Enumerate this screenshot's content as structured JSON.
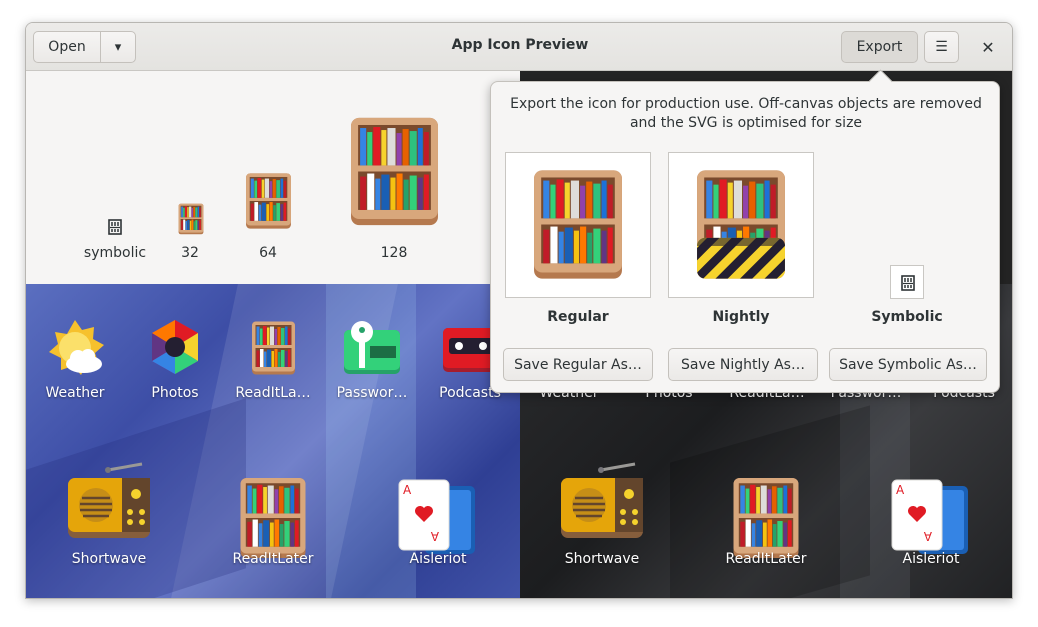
{
  "header": {
    "open_label": "Open",
    "title": "App Icon Preview",
    "export_label": "Export",
    "close_glyph": "✕",
    "menu_glyph": "☰",
    "dropdown_glyph": "▾"
  },
  "sizes": {
    "items": [
      {
        "label": "symbolic"
      },
      {
        "label": "32"
      },
      {
        "label": "64"
      },
      {
        "label": "128"
      }
    ]
  },
  "light_grid": {
    "row1": [
      {
        "label": "Weather",
        "icon": "weather-icon"
      },
      {
        "label": "Photos",
        "icon": "photos-icon"
      },
      {
        "label": "ReadItLa…",
        "icon": "readitlater-icon"
      },
      {
        "label": "Passwor…",
        "icon": "passwords-icon"
      },
      {
        "label": "Podcasts",
        "icon": "podcasts-icon"
      }
    ],
    "row2": [
      {
        "label": "Shortwave",
        "icon": "shortwave-icon"
      },
      {
        "label": "ReadItLater",
        "icon": "readitlater-icon"
      },
      {
        "label": "Aisleriot",
        "icon": "aisleriot-icon"
      }
    ]
  },
  "dark_grid": {
    "row1": [
      {
        "label": "Weather"
      },
      {
        "label": "Photos"
      },
      {
        "label": "ReadItLa…"
      },
      {
        "label": "Passwor…"
      },
      {
        "label": "Podcasts"
      }
    ],
    "row2": [
      {
        "label": "Shortwave",
        "icon": "shortwave-icon"
      },
      {
        "label": "ReadItLater",
        "icon": "readitlater-icon"
      },
      {
        "label": "Aisleriot",
        "icon": "aisleriot-icon"
      }
    ]
  },
  "export_popover": {
    "description": "Export the icon for production use. Off-canvas objects are removed and the SVG is optimised for size",
    "variants": [
      {
        "label": "Regular",
        "button": "Save Regular As…"
      },
      {
        "label": "Nightly",
        "button": "Save Nightly As…"
      },
      {
        "label": "Symbolic",
        "button": "Save Symbolic As…"
      }
    ]
  },
  "colors": {
    "accent_light_bg": "#4a5bb0",
    "dark_bg": "#242424",
    "shelf_wood": "#c8956a"
  }
}
